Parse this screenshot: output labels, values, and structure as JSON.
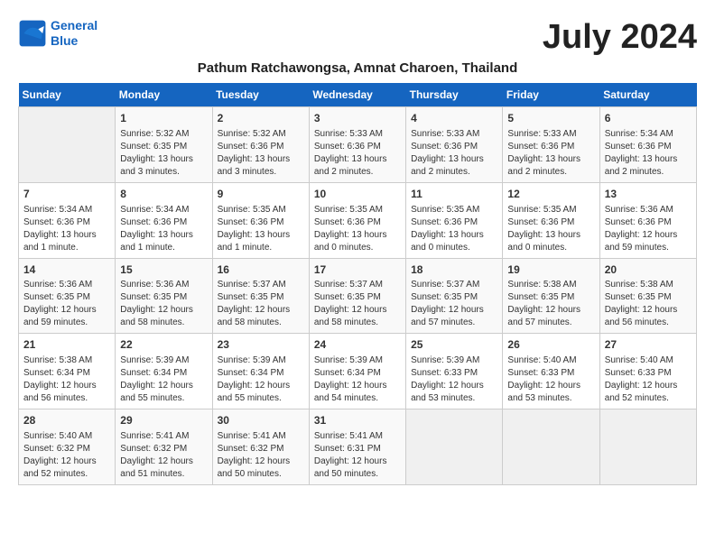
{
  "header": {
    "logo_line1": "General",
    "logo_line2": "Blue",
    "month_year": "July 2024",
    "location": "Pathum Ratchawongsa, Amnat Charoen, Thailand"
  },
  "days_of_week": [
    "Sunday",
    "Monday",
    "Tuesday",
    "Wednesday",
    "Thursday",
    "Friday",
    "Saturday"
  ],
  "weeks": [
    [
      {
        "day": "",
        "info": ""
      },
      {
        "day": "1",
        "info": "Sunrise: 5:32 AM\nSunset: 6:35 PM\nDaylight: 13 hours\nand 3 minutes."
      },
      {
        "day": "2",
        "info": "Sunrise: 5:32 AM\nSunset: 6:36 PM\nDaylight: 13 hours\nand 3 minutes."
      },
      {
        "day": "3",
        "info": "Sunrise: 5:33 AM\nSunset: 6:36 PM\nDaylight: 13 hours\nand 2 minutes."
      },
      {
        "day": "4",
        "info": "Sunrise: 5:33 AM\nSunset: 6:36 PM\nDaylight: 13 hours\nand 2 minutes."
      },
      {
        "day": "5",
        "info": "Sunrise: 5:33 AM\nSunset: 6:36 PM\nDaylight: 13 hours\nand 2 minutes."
      },
      {
        "day": "6",
        "info": "Sunrise: 5:34 AM\nSunset: 6:36 PM\nDaylight: 13 hours\nand 2 minutes."
      }
    ],
    [
      {
        "day": "7",
        "info": "Sunrise: 5:34 AM\nSunset: 6:36 PM\nDaylight: 13 hours\nand 1 minute."
      },
      {
        "day": "8",
        "info": "Sunrise: 5:34 AM\nSunset: 6:36 PM\nDaylight: 13 hours\nand 1 minute."
      },
      {
        "day": "9",
        "info": "Sunrise: 5:35 AM\nSunset: 6:36 PM\nDaylight: 13 hours\nand 1 minute."
      },
      {
        "day": "10",
        "info": "Sunrise: 5:35 AM\nSunset: 6:36 PM\nDaylight: 13 hours\nand 0 minutes."
      },
      {
        "day": "11",
        "info": "Sunrise: 5:35 AM\nSunset: 6:36 PM\nDaylight: 13 hours\nand 0 minutes."
      },
      {
        "day": "12",
        "info": "Sunrise: 5:35 AM\nSunset: 6:36 PM\nDaylight: 13 hours\nand 0 minutes."
      },
      {
        "day": "13",
        "info": "Sunrise: 5:36 AM\nSunset: 6:36 PM\nDaylight: 12 hours\nand 59 minutes."
      }
    ],
    [
      {
        "day": "14",
        "info": "Sunrise: 5:36 AM\nSunset: 6:35 PM\nDaylight: 12 hours\nand 59 minutes."
      },
      {
        "day": "15",
        "info": "Sunrise: 5:36 AM\nSunset: 6:35 PM\nDaylight: 12 hours\nand 58 minutes."
      },
      {
        "day": "16",
        "info": "Sunrise: 5:37 AM\nSunset: 6:35 PM\nDaylight: 12 hours\nand 58 minutes."
      },
      {
        "day": "17",
        "info": "Sunrise: 5:37 AM\nSunset: 6:35 PM\nDaylight: 12 hours\nand 58 minutes."
      },
      {
        "day": "18",
        "info": "Sunrise: 5:37 AM\nSunset: 6:35 PM\nDaylight: 12 hours\nand 57 minutes."
      },
      {
        "day": "19",
        "info": "Sunrise: 5:38 AM\nSunset: 6:35 PM\nDaylight: 12 hours\nand 57 minutes."
      },
      {
        "day": "20",
        "info": "Sunrise: 5:38 AM\nSunset: 6:35 PM\nDaylight: 12 hours\nand 56 minutes."
      }
    ],
    [
      {
        "day": "21",
        "info": "Sunrise: 5:38 AM\nSunset: 6:34 PM\nDaylight: 12 hours\nand 56 minutes."
      },
      {
        "day": "22",
        "info": "Sunrise: 5:39 AM\nSunset: 6:34 PM\nDaylight: 12 hours\nand 55 minutes."
      },
      {
        "day": "23",
        "info": "Sunrise: 5:39 AM\nSunset: 6:34 PM\nDaylight: 12 hours\nand 55 minutes."
      },
      {
        "day": "24",
        "info": "Sunrise: 5:39 AM\nSunset: 6:34 PM\nDaylight: 12 hours\nand 54 minutes."
      },
      {
        "day": "25",
        "info": "Sunrise: 5:39 AM\nSunset: 6:33 PM\nDaylight: 12 hours\nand 53 minutes."
      },
      {
        "day": "26",
        "info": "Sunrise: 5:40 AM\nSunset: 6:33 PM\nDaylight: 12 hours\nand 53 minutes."
      },
      {
        "day": "27",
        "info": "Sunrise: 5:40 AM\nSunset: 6:33 PM\nDaylight: 12 hours\nand 52 minutes."
      }
    ],
    [
      {
        "day": "28",
        "info": "Sunrise: 5:40 AM\nSunset: 6:32 PM\nDaylight: 12 hours\nand 52 minutes."
      },
      {
        "day": "29",
        "info": "Sunrise: 5:41 AM\nSunset: 6:32 PM\nDaylight: 12 hours\nand 51 minutes."
      },
      {
        "day": "30",
        "info": "Sunrise: 5:41 AM\nSunset: 6:32 PM\nDaylight: 12 hours\nand 50 minutes."
      },
      {
        "day": "31",
        "info": "Sunrise: 5:41 AM\nSunset: 6:31 PM\nDaylight: 12 hours\nand 50 minutes."
      },
      {
        "day": "",
        "info": ""
      },
      {
        "day": "",
        "info": ""
      },
      {
        "day": "",
        "info": ""
      }
    ]
  ]
}
